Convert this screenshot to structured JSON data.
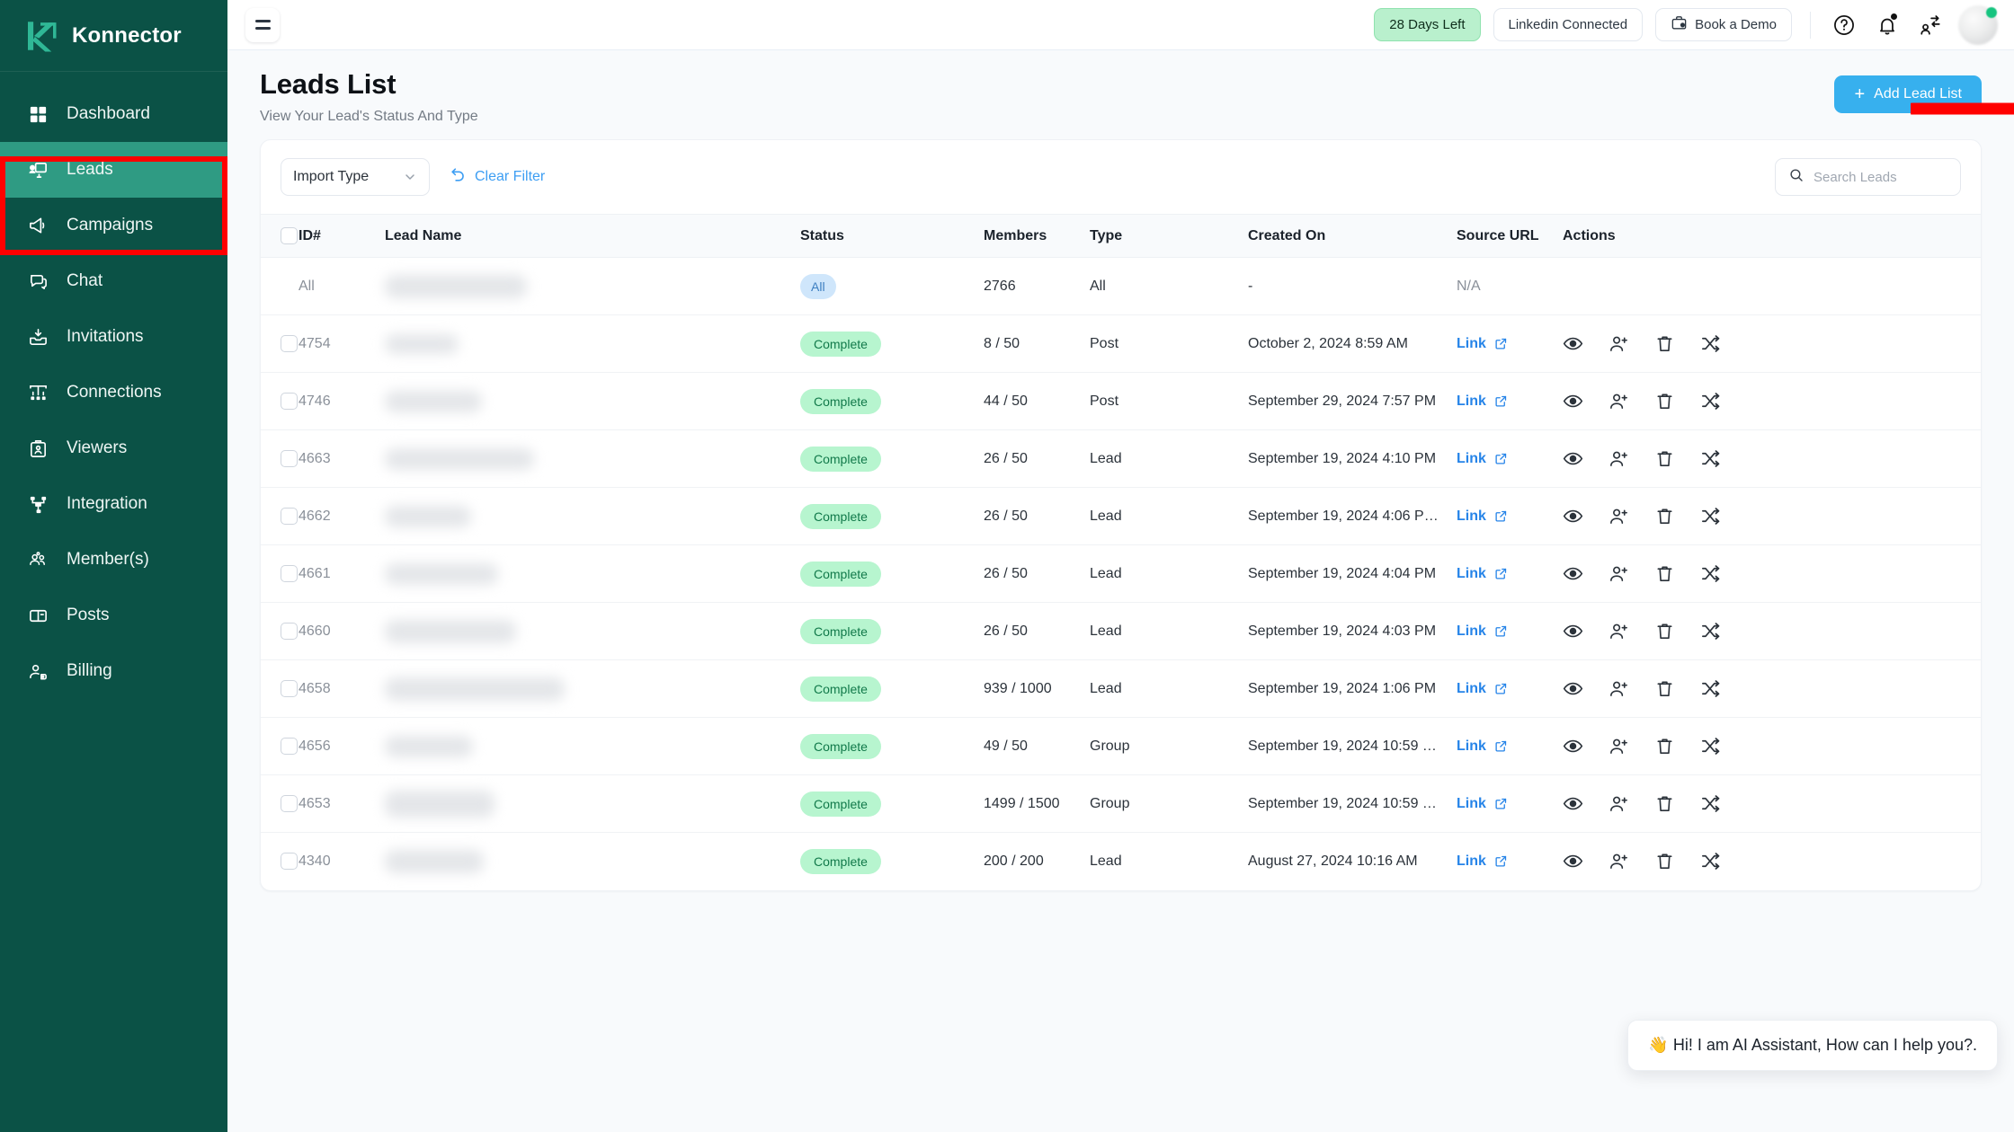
{
  "brand": {
    "name": "Konnector",
    "logo_icon": "konnector-k-logo"
  },
  "sidebar": {
    "items": [
      {
        "label": "Dashboard",
        "icon": "grid-icon",
        "active": false
      },
      {
        "label": "Leads",
        "icon": "leads-icon",
        "active": true
      },
      {
        "label": "Campaigns",
        "icon": "megaphone-icon",
        "active": false
      },
      {
        "label": "Chat",
        "icon": "chat-bubbles-icon",
        "active": false
      },
      {
        "label": "Invitations",
        "icon": "inbox-download-icon",
        "active": false
      },
      {
        "label": "Connections",
        "icon": "connections-icon",
        "active": false
      },
      {
        "label": "Viewers",
        "icon": "id-badge-icon",
        "active": false
      },
      {
        "label": "Integration",
        "icon": "integration-nodes-icon",
        "active": false
      },
      {
        "label": "Member(s)",
        "icon": "users-group-icon",
        "active": false
      },
      {
        "label": "Posts",
        "icon": "posts-icon",
        "active": false
      },
      {
        "label": "Billing",
        "icon": "user-tag-icon",
        "active": false
      }
    ]
  },
  "topbar": {
    "menu_icon": "hamburger-icon",
    "trial_badge": "28 Days Left",
    "linkedin_status": "Linkedin Connected",
    "book_demo": "Book a Demo",
    "book_demo_icon": "briefcase-icon",
    "help_icon": "help-circle-icon",
    "bell_icon": "bell-icon",
    "switch_account_icon": "switch-account-icon",
    "avatar_icon": "avatar"
  },
  "page": {
    "title": "Leads List",
    "subtitle": "View Your Lead's Status And Type",
    "add_button": "Add Lead List",
    "add_button_plus": "+",
    "add_button_color": "#37b0ee",
    "annotation": "red-arrow pointing at Add Lead List button"
  },
  "filters": {
    "import_type_label": "Import Type",
    "import_type_icon": "chevron-down-icon",
    "clear_filter": "Clear Filter",
    "clear_filter_icon": "undo-icon",
    "search_placeholder": "Search Leads",
    "search_value": "",
    "search_icon": "search-icon"
  },
  "table": {
    "columns": [
      "ID#",
      "Lead Name",
      "Status",
      "Members",
      "Type",
      "Created On",
      "Source URL",
      "Actions"
    ],
    "rows": [
      {
        "id": "All",
        "name": "",
        "name_redacted": true,
        "redact_w": 158,
        "redact_h": 26,
        "status": "All",
        "status_kind": "all",
        "members": "2766",
        "type": "All",
        "created": "-",
        "source": "N/A",
        "source_kind": "text",
        "checkbox": false,
        "actions": false
      },
      {
        "id": "4754",
        "name": "",
        "name_redacted": true,
        "redact_w": 82,
        "redact_h": 22,
        "status": "Complete",
        "status_kind": "complete",
        "members": "8 / 50",
        "type": "Post",
        "created": "October 2, 2024 8:59 AM",
        "source": "Link",
        "source_kind": "link",
        "checkbox": true,
        "actions": true
      },
      {
        "id": "4746",
        "name": "",
        "name_redacted": true,
        "redact_w": 108,
        "redact_h": 24,
        "status": "Complete",
        "status_kind": "complete",
        "members": "44 / 50",
        "type": "Post",
        "created": "September 29, 2024 7:57 PM",
        "source": "Link",
        "source_kind": "link",
        "checkbox": true,
        "actions": true
      },
      {
        "id": "4663",
        "name": "",
        "name_redacted": true,
        "redact_w": 166,
        "redact_h": 24,
        "status": "Complete",
        "status_kind": "complete",
        "members": "26 / 50",
        "type": "Lead",
        "created": "September 19, 2024 4:10 PM",
        "source": "Link",
        "source_kind": "link",
        "checkbox": true,
        "actions": true
      },
      {
        "id": "4662",
        "name": "",
        "name_redacted": true,
        "redact_w": 96,
        "redact_h": 24,
        "status": "Complete",
        "status_kind": "complete",
        "members": "26 / 50",
        "type": "Lead",
        "created": "September 19, 2024 4:06 P…",
        "source": "Link",
        "source_kind": "link",
        "checkbox": true,
        "actions": true
      },
      {
        "id": "4661",
        "name": "",
        "name_redacted": true,
        "redact_w": 126,
        "redact_h": 24,
        "status": "Complete",
        "status_kind": "complete",
        "members": "26 / 50",
        "type": "Lead",
        "created": "September 19, 2024 4:04 PM",
        "source": "Link",
        "source_kind": "link",
        "checkbox": true,
        "actions": true
      },
      {
        "id": "4660",
        "name": "",
        "name_redacted": true,
        "redact_w": 146,
        "redact_h": 26,
        "status": "Complete",
        "status_kind": "complete",
        "members": "26 / 50",
        "type": "Lead",
        "created": "September 19, 2024 4:03 PM",
        "source": "Link",
        "source_kind": "link",
        "checkbox": true,
        "actions": true
      },
      {
        "id": "4658",
        "name": "",
        "name_redacted": true,
        "redact_w": 200,
        "redact_h": 26,
        "status": "Complete",
        "status_kind": "complete",
        "members": "939 / 1000",
        "type": "Lead",
        "created": "September 19, 2024 1:06 PM",
        "source": "Link",
        "source_kind": "link",
        "checkbox": true,
        "actions": true
      },
      {
        "id": "4656",
        "name": "",
        "name_redacted": true,
        "redact_w": 98,
        "redact_h": 24,
        "status": "Complete",
        "status_kind": "complete",
        "members": "49 / 50",
        "type": "Group",
        "created": "September 19, 2024 10:59 …",
        "source": "Link",
        "source_kind": "link",
        "checkbox": true,
        "actions": true
      },
      {
        "id": "4653",
        "name": "",
        "name_redacted": true,
        "redact_w": 122,
        "redact_h": 30,
        "status": "Complete",
        "status_kind": "complete",
        "members": "1499 / 1500",
        "type": "Group",
        "created": "September 19, 2024 10:59 …",
        "source": "Link",
        "source_kind": "link",
        "checkbox": true,
        "actions": true
      },
      {
        "id": "4340",
        "name": "",
        "name_redacted": true,
        "redact_w": 110,
        "redact_h": 26,
        "status": "Complete",
        "status_kind": "complete",
        "members": "200 / 200",
        "type": "Lead",
        "created": "August 27, 2024 10:16 AM",
        "source": "Link",
        "source_kind": "link",
        "checkbox": true,
        "actions": true
      }
    ],
    "action_icons": [
      "eye-icon",
      "user-add-icon",
      "trash-icon",
      "shuffle-icon"
    ]
  },
  "ai_assistant": {
    "message": "👋 Hi! I am AI Assistant, How can I help you?."
  },
  "colors": {
    "sidebar_bg": "#0b5246",
    "sidebar_active": "#2f9b83",
    "accent_blue": "#37b0ee",
    "link_blue": "#2684e8",
    "badge_green_bg": "#b7f5cf",
    "badge_green_text": "#11794a",
    "badge_all_bg": "#cfe6fb",
    "annotation_red": "#ff0000"
  }
}
